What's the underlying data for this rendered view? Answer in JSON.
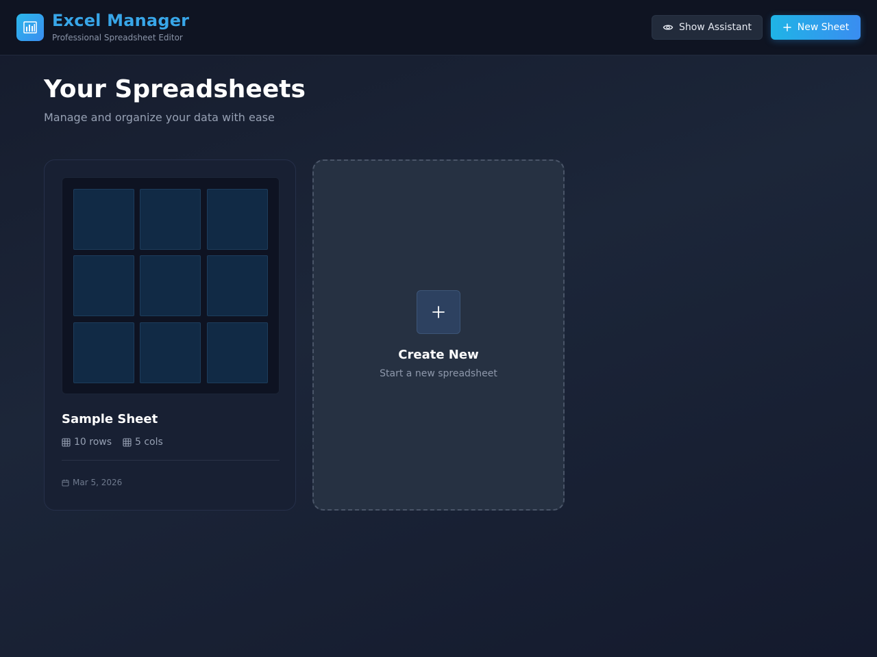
{
  "app": {
    "title": "Excel Manager",
    "subtitle": "Professional Spreadsheet Editor",
    "logo_icon": "bar-chart-icon",
    "accent_color": "#38a6e8"
  },
  "header": {
    "show_assistant_label": "Show Assistant",
    "show_assistant_icon": "eye-icon",
    "new_sheet_label": "New Sheet",
    "new_sheet_icon": "plus-icon"
  },
  "main": {
    "title": "Your Spreadsheets",
    "subtitle": "Manage and organize your data with ease"
  },
  "sheets": [
    {
      "name": "Sample Sheet",
      "rows_label": "10 rows",
      "cols_label": "5 cols",
      "date": "Mar 5, 2026",
      "rows_icon": "grid-icon",
      "cols_icon": "grid-icon",
      "date_icon": "calendar-icon"
    }
  ],
  "create_card": {
    "title": "Create New",
    "subtitle": "Start a new spreadsheet",
    "icon": "plus-icon"
  }
}
